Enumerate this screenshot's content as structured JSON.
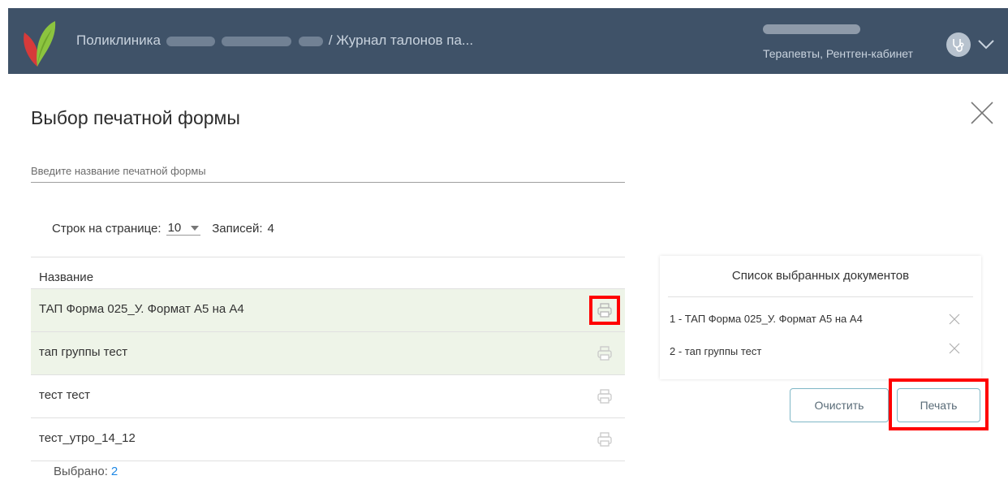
{
  "header": {
    "breadcrumb_prefix": "Поликлиника",
    "breadcrumb_suffix": "/ Журнал талонов па...",
    "user_role": "Терапевты, Рентген-кабинет"
  },
  "modal": {
    "title": "Выбор печатной формы",
    "search_placeholder": "Введите название печатной формы"
  },
  "pager": {
    "rows_label": "Строк на странице:",
    "rows_value": "10",
    "records_label": "Записей:",
    "records_count": "4"
  },
  "table": {
    "header": "Название",
    "rows": [
      {
        "name": "ТАП Форма 025_У. Формат А5 на А4",
        "selected": true
      },
      {
        "name": "тап группы тест",
        "selected": true
      },
      {
        "name": "тест тест",
        "selected": false
      },
      {
        "name": "тест_утро_14_12",
        "selected": false
      }
    ],
    "selected_label": "Выбрано:",
    "selected_count": "2"
  },
  "selected_panel": {
    "title": "Список выбранных документов",
    "items": [
      "1 - ТАП Форма 025_У. Формат А5 на А4",
      "2 - тап группы тест"
    ]
  },
  "buttons": {
    "clear": "Очистить",
    "print": "Печать"
  },
  "colors": {
    "topbar": "#3f5268",
    "selected_row": "#eef4e8",
    "highlight": "#ff0000",
    "accent": "#1e88e5"
  }
}
